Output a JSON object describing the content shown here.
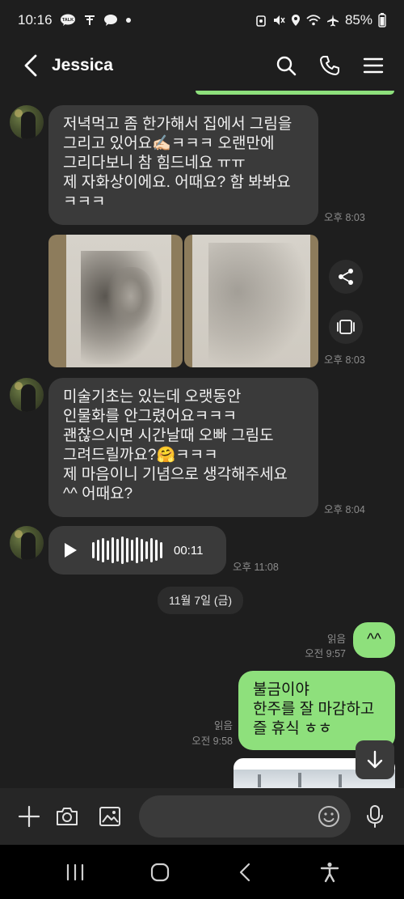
{
  "status_bar": {
    "time": "10:16",
    "talk_badge": "TALK",
    "battery": "85%"
  },
  "header": {
    "back_icon": "chevron-left-icon",
    "title": "Jessica",
    "actions": [
      "search-icon",
      "phone-icon",
      "menu-icon"
    ]
  },
  "messages": [
    {
      "type": "text",
      "direction": "incoming",
      "lines": [
        "저녁먹고 좀 한가해서 집에서 그림을",
        "그리고 있어요✍🏻ㅋㅋㅋ 오랜만에",
        "그리다보니 참 힘드네요 ㅠㅠ",
        "제 자화상이에요. 어때요? 함 봐봐요",
        "ㅋㅋㅋ"
      ],
      "time": "오후 8:03"
    },
    {
      "type": "photos",
      "direction": "incoming",
      "count": 2,
      "time": "오후 8:03",
      "actions": [
        "share-icon",
        "gallery-icon"
      ]
    },
    {
      "type": "text",
      "direction": "incoming",
      "lines": [
        "미술기초는 있는데 오랫동안",
        "인물화를 안그렸어요ㅋㅋㅋ",
        "괜찮으시면 시간날때 오빠 그림도",
        "그려드릴까요?🤗ㅋㅋㅋ",
        "제 마음이니 기념으로 생각해주세요",
        "^^ 어때요?"
      ],
      "time": "오후 8:04"
    },
    {
      "type": "voice",
      "direction": "incoming",
      "duration": "00:11",
      "time": "오후 11:08"
    },
    {
      "type": "date",
      "label": "11월 7일 (금)"
    },
    {
      "type": "text",
      "direction": "outgoing",
      "lines": [
        "^^"
      ],
      "read": "읽음",
      "time": "오전 9:57"
    },
    {
      "type": "text",
      "direction": "outgoing",
      "lines": [
        "불금이야",
        "한주를 잘 마감하고",
        "즐 휴식 ㅎㅎ"
      ],
      "read": "읽음",
      "time": "오전 9:58"
    }
  ],
  "input_bar": {
    "placeholder": "",
    "buttons": [
      "plus-icon",
      "camera-icon",
      "image-icon",
      "emoji-icon",
      "microphone-icon"
    ]
  },
  "nav_bar": [
    "recents-icon",
    "home-icon",
    "back-icon",
    "accessibility-icon"
  ],
  "colors": {
    "background": "#1e1e1e",
    "incoming_bubble": "#3a3a3a",
    "outgoing_bubble": "#8ee07c",
    "timestamp": "#8c8c8c"
  }
}
